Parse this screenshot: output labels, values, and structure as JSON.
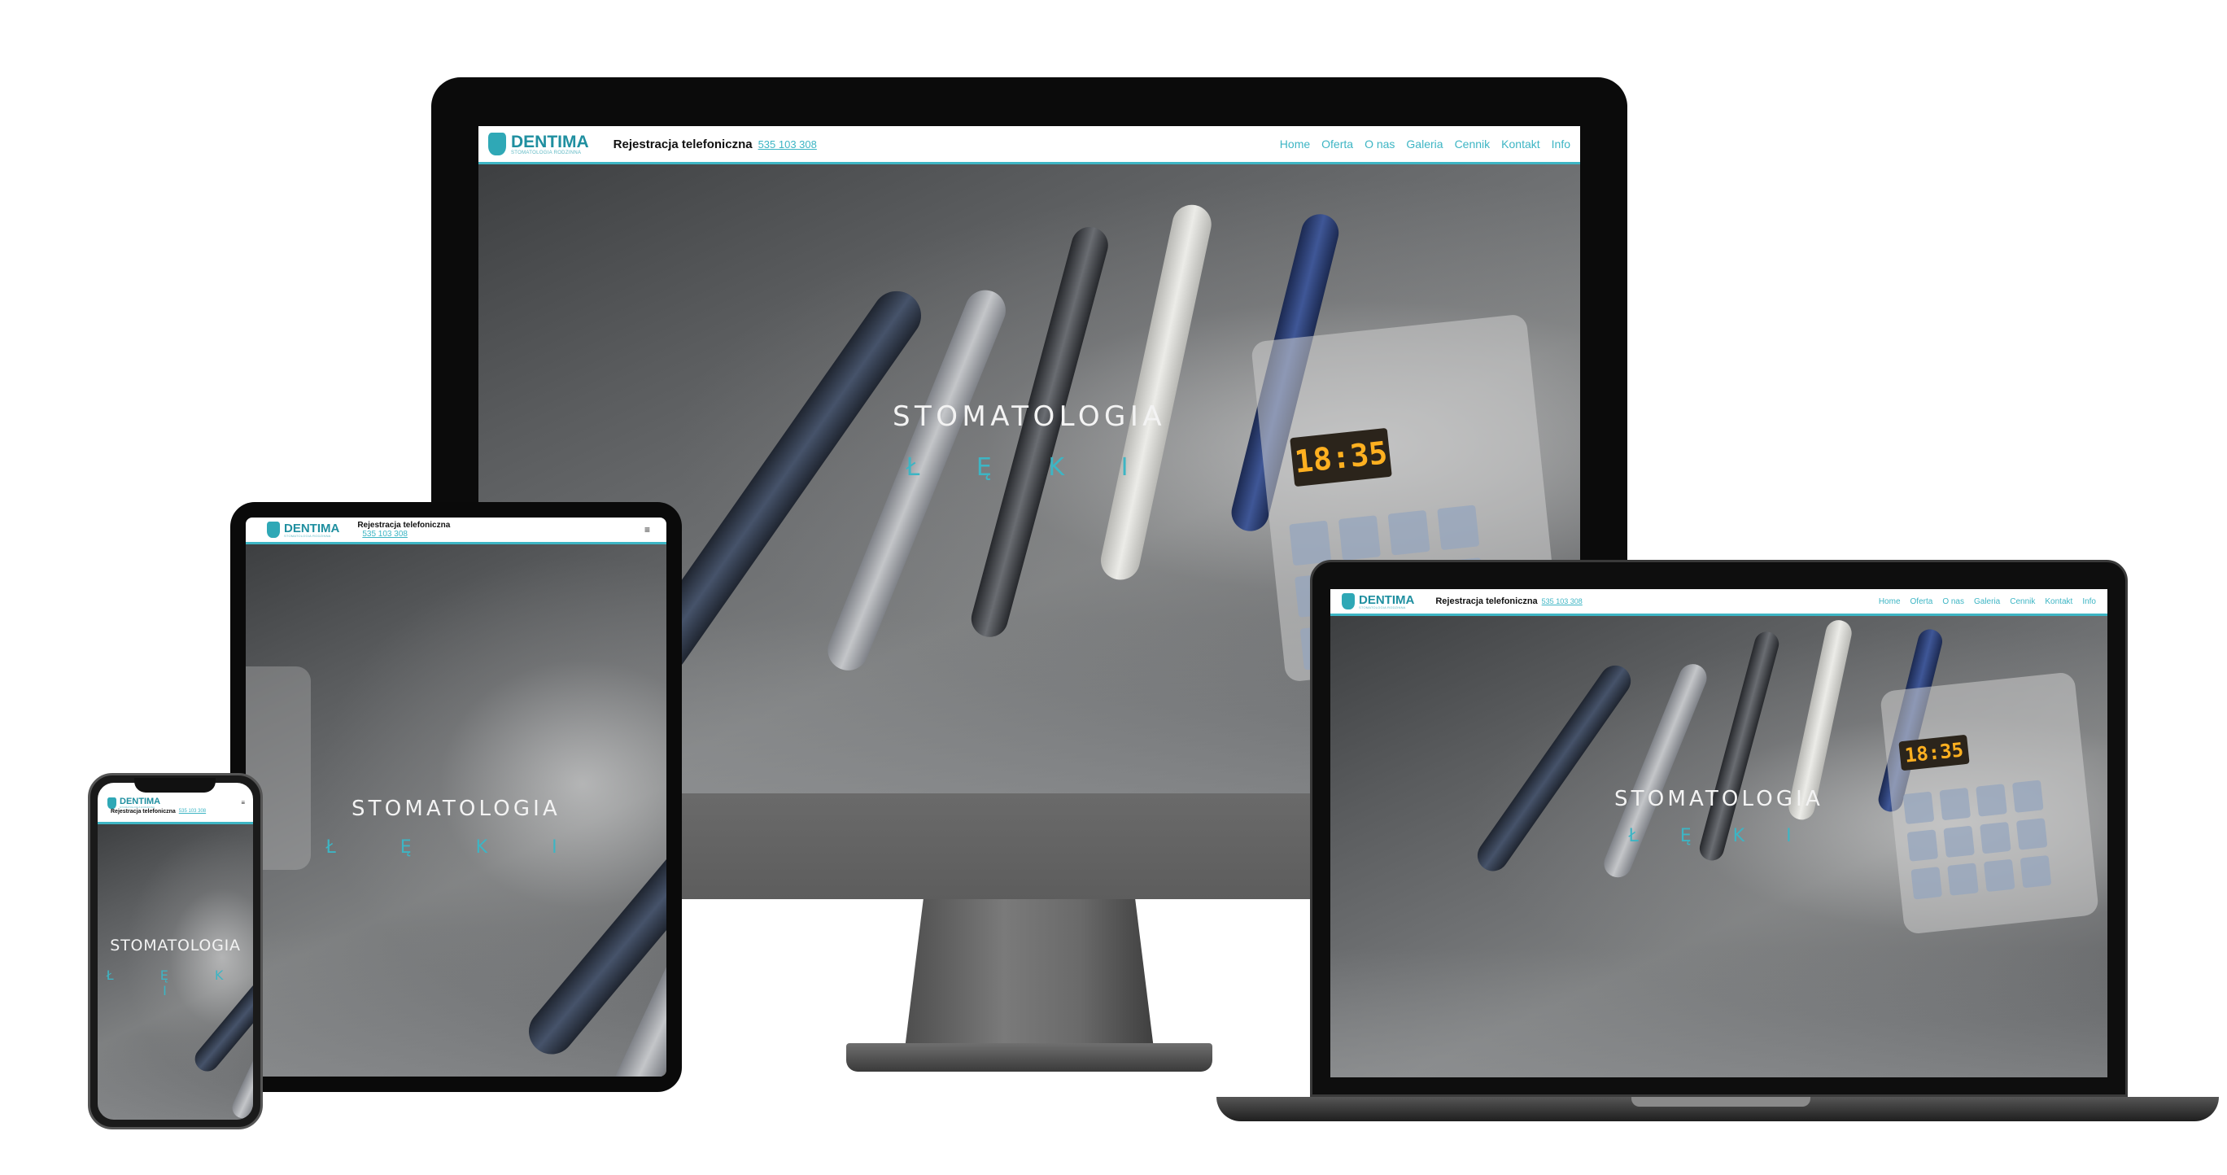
{
  "site": {
    "brand": "DENTIMA",
    "tagline": "STOMATOLOGIA RODZINNA",
    "registration_label": "Rejestracja telefoniczna",
    "phone": "535 103 308",
    "nav": [
      "Home",
      "Oferta",
      "O nas",
      "Galeria",
      "Cennik",
      "Kontakt",
      "Info"
    ],
    "menu_icon": "≡",
    "hero_title": "STOMATOLOGIA",
    "hero_sub": "Ł Ę K I",
    "lcd_value": "18:35",
    "accent": "#3db5c4"
  },
  "devices": [
    "desktop-monitor",
    "laptop",
    "tablet",
    "phone"
  ],
  "icons": {
    "logo": "tooth-icon",
    "menu": "hamburger-menu-icon"
  }
}
